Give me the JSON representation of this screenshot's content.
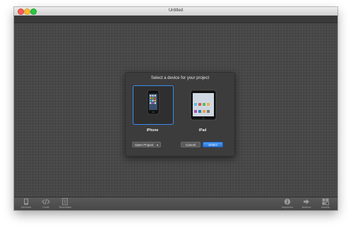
{
  "window": {
    "title": "Untitled"
  },
  "dialog": {
    "title": "Select a device for your project",
    "devices": [
      {
        "label": "iPhone",
        "selected": true
      },
      {
        "label": "iPad",
        "selected": false
      }
    ],
    "open_project_label": "Open Project",
    "cancel_label": "Cancel",
    "select_label": "Select"
  },
  "bottombar": {
    "left_items": [
      {
        "label": "Devices",
        "icon": "device-icon"
      },
      {
        "label": "Code",
        "icon": "code-icon"
      },
      {
        "label": "Templates",
        "icon": "templates-icon"
      }
    ],
    "right_items": [
      {
        "label": "Inspector",
        "icon": "info-icon"
      },
      {
        "label": "Actions",
        "icon": "arrow-icon"
      },
      {
        "label": "Assets",
        "icon": "assets-icon"
      }
    ]
  },
  "colors": {
    "accent": "#3a8ef0",
    "canvas": "#454545"
  }
}
